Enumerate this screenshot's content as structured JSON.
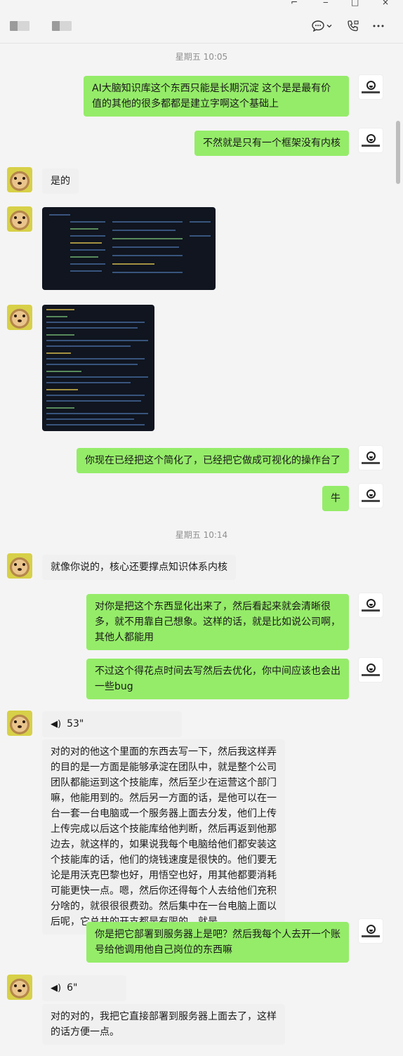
{
  "header": {
    "contact_name_1": "",
    "contact_name_2": "",
    "icons": [
      "chat-bubble-icon",
      "chevron-down-icon",
      "video-call-icon",
      "more-icon"
    ]
  },
  "timestamps": [
    "星期五 10:05",
    "星期五 10:14"
  ],
  "messages": [
    {
      "from": "me",
      "text": "AI大脑知识库这个东西只能是长期沉淀 这个是是最有价值的其他的很多都都是建立字啊这个基础上"
    },
    {
      "from": "me",
      "text": "不然就是只有一个框架没有内核"
    },
    {
      "from": "other",
      "text": "是的"
    },
    {
      "from": "other",
      "type": "image"
    },
    {
      "from": "other",
      "type": "image"
    },
    {
      "from": "me",
      "text": "你现在已经把这个简化了，已经把它做成可视化的操作台了"
    },
    {
      "from": "me",
      "text": "牛"
    },
    {
      "from": "other",
      "text": "就像你说的，核心还要撑点知识体系内核"
    },
    {
      "from": "me",
      "text": "对你是把这个东西显化出来了，然后看起来就会清晰很多，就不用靠自己想象。这样的话，就是比如说公司啊，其他人都能用"
    },
    {
      "from": "me",
      "text": "不过这个得花点时间去写然后去优化，你中间应该也会出一些bug"
    },
    {
      "from": "other",
      "type": "voice",
      "duration": "53\""
    },
    {
      "from": "other",
      "text": "对的对的他这个里面的东西去写一下，然后我这样弄的目的是一方面是能够承淀在团队中，就是整个公司团队都能运到这个技能库，然后至少在运营这个部门嘛，他能用到的。然后另一方面的话，是他可以在一台一套一台电脑或一个服务器上面去分发，他们上传上传完成以后这个技能库给他判断，然后再返到他那边去，就这样的，如果说我每个电脑给他们都安装这个技能库的话，他们的烧钱速度是很快的。他们要无论是用沃克巴黎也好，用悟空也好，用其他都要消耗可能更快一点。嗯，然后你还得每个人去给他们充积分啥的，就很很很费劲。然后集中在一台电脑上面以后呢，它总共的开支都是有限的，就是。"
    },
    {
      "from": "me",
      "text": "你是把它部署到服务器上是吧？然后我每个人去开一个账号给他调用他自己岗位的东西嘛"
    },
    {
      "from": "other",
      "type": "voice",
      "duration": "6\""
    },
    {
      "from": "other",
      "text": "对的对的，我把它直接部署到服务器上面去了，这样的话方便一点。"
    }
  ]
}
